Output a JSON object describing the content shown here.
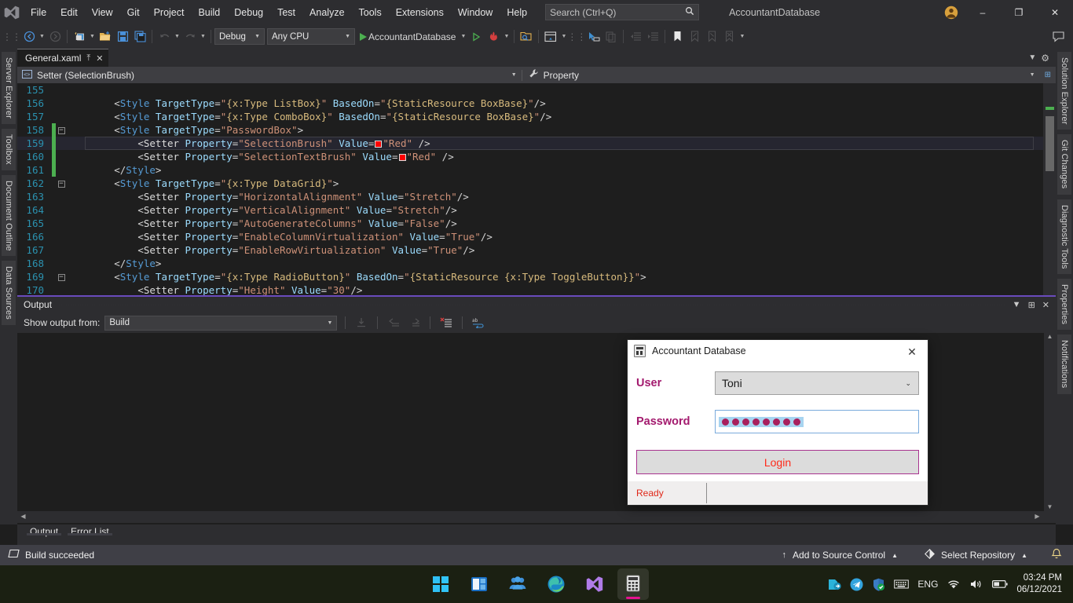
{
  "titlebar": {
    "menu": [
      "File",
      "Edit",
      "View",
      "Git",
      "Project",
      "Build",
      "Debug",
      "Test",
      "Analyze",
      "Tools",
      "Extensions",
      "Window",
      "Help"
    ],
    "search_placeholder": "Search (Ctrl+Q)",
    "search_icon": "magnifier-icon",
    "solution_title": "AccountantDatabase",
    "minimize": "–",
    "maximize": "❐",
    "close": "✕"
  },
  "toolbar": {
    "config": "Debug",
    "platform": "Any CPU",
    "start_label": "AccountantDatabase"
  },
  "dock_left": [
    "Server Explorer",
    "Toolbox",
    "Document Outline",
    "Data Sources"
  ],
  "dock_right": [
    "Solution Explorer",
    "Git Changes",
    "Diagnostic Tools",
    "Properties",
    "Notifications"
  ],
  "editor": {
    "tab_name": "General.xaml",
    "tab_pin": "⤒",
    "tab_close": "✕",
    "breadcrumb_left": "Setter (SelectionBrush)",
    "breadcrumb_right": "Property",
    "breadcrumb_left_icon": "code-tag-icon",
    "breadcrumb_right_icon": "wrench-icon",
    "lines": [
      {
        "num": "155",
        "fold": "",
        "changed": false,
        "parts": []
      },
      {
        "num": "156",
        "fold": "",
        "changed": false,
        "parts": [
          {
            "t": "        ",
            "c": "k-punct"
          },
          {
            "t": "<",
            "c": "k-punct"
          },
          {
            "t": "Style",
            "c": "k-tag"
          },
          {
            "t": " ",
            "c": "k-punct"
          },
          {
            "t": "TargetType",
            "c": "k-attr"
          },
          {
            "t": "=",
            "c": "k-punct"
          },
          {
            "t": "\"",
            "c": "k-str"
          },
          {
            "t": "{x:Type ",
            "c": "k-brace"
          },
          {
            "t": "ListBox",
            "c": "k-brace"
          },
          {
            "t": "}",
            "c": "k-brace"
          },
          {
            "t": "\"",
            "c": "k-str"
          },
          {
            "t": " ",
            "c": "k-punct"
          },
          {
            "t": "BasedOn",
            "c": "k-attr"
          },
          {
            "t": "=",
            "c": "k-punct"
          },
          {
            "t": "\"",
            "c": "k-str"
          },
          {
            "t": "{StaticResource ",
            "c": "k-brace"
          },
          {
            "t": "BoxBase",
            "c": "k-brace"
          },
          {
            "t": "}",
            "c": "k-brace"
          },
          {
            "t": "\"",
            "c": "k-str"
          },
          {
            "t": "/>",
            "c": "k-punct"
          }
        ]
      },
      {
        "num": "157",
        "fold": "",
        "changed": false,
        "parts": [
          {
            "t": "        ",
            "c": "k-punct"
          },
          {
            "t": "<",
            "c": "k-punct"
          },
          {
            "t": "Style",
            "c": "k-tag"
          },
          {
            "t": " ",
            "c": "k-punct"
          },
          {
            "t": "TargetType",
            "c": "k-attr"
          },
          {
            "t": "=",
            "c": "k-punct"
          },
          {
            "t": "\"",
            "c": "k-str"
          },
          {
            "t": "{x:Type ",
            "c": "k-brace"
          },
          {
            "t": "ComboBox",
            "c": "k-brace"
          },
          {
            "t": "}",
            "c": "k-brace"
          },
          {
            "t": "\"",
            "c": "k-str"
          },
          {
            "t": " ",
            "c": "k-punct"
          },
          {
            "t": "BasedOn",
            "c": "k-attr"
          },
          {
            "t": "=",
            "c": "k-punct"
          },
          {
            "t": "\"",
            "c": "k-str"
          },
          {
            "t": "{StaticResource ",
            "c": "k-brace"
          },
          {
            "t": "BoxBase",
            "c": "k-brace"
          },
          {
            "t": "}",
            "c": "k-brace"
          },
          {
            "t": "\"",
            "c": "k-str"
          },
          {
            "t": "/>",
            "c": "k-punct"
          }
        ]
      },
      {
        "num": "158",
        "fold": "-",
        "changed": true,
        "parts": [
          {
            "t": "        ",
            "c": "k-punct"
          },
          {
            "t": "<",
            "c": "k-punct"
          },
          {
            "t": "Style",
            "c": "k-tag"
          },
          {
            "t": " ",
            "c": "k-punct"
          },
          {
            "t": "TargetType",
            "c": "k-attr"
          },
          {
            "t": "=",
            "c": "k-punct"
          },
          {
            "t": "\"PasswordBox\"",
            "c": "k-str"
          },
          {
            "t": ">",
            "c": "k-punct"
          }
        ]
      },
      {
        "num": "159",
        "fold": "",
        "changed": true,
        "current": true,
        "parts": [
          {
            "t": "            ",
            "c": "k-punct"
          },
          {
            "t": "<",
            "c": "k-punct"
          },
          {
            "t": "Setter",
            "c": "k-white"
          },
          {
            "t": " ",
            "c": "k-punct"
          },
          {
            "t": "Property",
            "c": "k-attr"
          },
          {
            "t": "=",
            "c": "k-punct"
          },
          {
            "t": "\"SelectionBrush\"",
            "c": "k-str"
          },
          {
            "t": " ",
            "c": "k-punct"
          },
          {
            "t": "Value",
            "c": "k-attr"
          },
          {
            "t": "=",
            "c": "k-punct"
          },
          {
            "t": "@CHIP@",
            "c": "chip"
          },
          {
            "t": "\"Red\"",
            "c": "k-str"
          },
          {
            "t": " />",
            "c": "k-punct"
          }
        ]
      },
      {
        "num": "160",
        "fold": "",
        "changed": true,
        "parts": [
          {
            "t": "            ",
            "c": "k-punct"
          },
          {
            "t": "<",
            "c": "k-punct"
          },
          {
            "t": "Setter",
            "c": "k-white"
          },
          {
            "t": " ",
            "c": "k-punct"
          },
          {
            "t": "Property",
            "c": "k-attr"
          },
          {
            "t": "=",
            "c": "k-punct"
          },
          {
            "t": "\"SelectionTextBrush\"",
            "c": "k-str"
          },
          {
            "t": " ",
            "c": "k-punct"
          },
          {
            "t": "Value",
            "c": "k-attr"
          },
          {
            "t": "=",
            "c": "k-punct"
          },
          {
            "t": "@CHIP@",
            "c": "chip"
          },
          {
            "t": "\"Red\"",
            "c": "k-str"
          },
          {
            "t": " />",
            "c": "k-punct"
          }
        ]
      },
      {
        "num": "161",
        "fold": "",
        "changed": true,
        "parts": [
          {
            "t": "        ",
            "c": "k-punct"
          },
          {
            "t": "</",
            "c": "k-punct"
          },
          {
            "t": "Style",
            "c": "k-tag"
          },
          {
            "t": ">",
            "c": "k-punct"
          }
        ]
      },
      {
        "num": "162",
        "fold": "-",
        "changed": false,
        "parts": [
          {
            "t": "        ",
            "c": "k-punct"
          },
          {
            "t": "<",
            "c": "k-punct"
          },
          {
            "t": "Style",
            "c": "k-tag"
          },
          {
            "t": " ",
            "c": "k-punct"
          },
          {
            "t": "TargetType",
            "c": "k-attr"
          },
          {
            "t": "=",
            "c": "k-punct"
          },
          {
            "t": "\"",
            "c": "k-str"
          },
          {
            "t": "{x:Type ",
            "c": "k-brace"
          },
          {
            "t": "DataGrid",
            "c": "k-brace"
          },
          {
            "t": "}",
            "c": "k-brace"
          },
          {
            "t": "\"",
            "c": "k-str"
          },
          {
            "t": ">",
            "c": "k-punct"
          }
        ]
      },
      {
        "num": "163",
        "fold": "",
        "changed": false,
        "parts": [
          {
            "t": "            ",
            "c": "k-punct"
          },
          {
            "t": "<",
            "c": "k-punct"
          },
          {
            "t": "Setter",
            "c": "k-white"
          },
          {
            "t": " ",
            "c": "k-punct"
          },
          {
            "t": "Property",
            "c": "k-attr"
          },
          {
            "t": "=",
            "c": "k-punct"
          },
          {
            "t": "\"HorizontalAlignment\"",
            "c": "k-str"
          },
          {
            "t": " ",
            "c": "k-punct"
          },
          {
            "t": "Value",
            "c": "k-attr"
          },
          {
            "t": "=",
            "c": "k-punct"
          },
          {
            "t": "\"Stretch\"",
            "c": "k-str"
          },
          {
            "t": "/>",
            "c": "k-punct"
          }
        ]
      },
      {
        "num": "164",
        "fold": "",
        "changed": false,
        "parts": [
          {
            "t": "            ",
            "c": "k-punct"
          },
          {
            "t": "<",
            "c": "k-punct"
          },
          {
            "t": "Setter",
            "c": "k-white"
          },
          {
            "t": " ",
            "c": "k-punct"
          },
          {
            "t": "Property",
            "c": "k-attr"
          },
          {
            "t": "=",
            "c": "k-punct"
          },
          {
            "t": "\"VerticalAlignment\"",
            "c": "k-str"
          },
          {
            "t": " ",
            "c": "k-punct"
          },
          {
            "t": "Value",
            "c": "k-attr"
          },
          {
            "t": "=",
            "c": "k-punct"
          },
          {
            "t": "\"Stretch\"",
            "c": "k-str"
          },
          {
            "t": "/>",
            "c": "k-punct"
          }
        ]
      },
      {
        "num": "165",
        "fold": "",
        "changed": false,
        "parts": [
          {
            "t": "            ",
            "c": "k-punct"
          },
          {
            "t": "<",
            "c": "k-punct"
          },
          {
            "t": "Setter",
            "c": "k-white"
          },
          {
            "t": " ",
            "c": "k-punct"
          },
          {
            "t": "Property",
            "c": "k-attr"
          },
          {
            "t": "=",
            "c": "k-punct"
          },
          {
            "t": "\"AutoGenerateColumns\"",
            "c": "k-str"
          },
          {
            "t": " ",
            "c": "k-punct"
          },
          {
            "t": "Value",
            "c": "k-attr"
          },
          {
            "t": "=",
            "c": "k-punct"
          },
          {
            "t": "\"False\"",
            "c": "k-str"
          },
          {
            "t": "/>",
            "c": "k-punct"
          }
        ]
      },
      {
        "num": "166",
        "fold": "",
        "changed": false,
        "parts": [
          {
            "t": "            ",
            "c": "k-punct"
          },
          {
            "t": "<",
            "c": "k-punct"
          },
          {
            "t": "Setter",
            "c": "k-white"
          },
          {
            "t": " ",
            "c": "k-punct"
          },
          {
            "t": "Property",
            "c": "k-attr"
          },
          {
            "t": "=",
            "c": "k-punct"
          },
          {
            "t": "\"EnableColumnVirtualization\"",
            "c": "k-str"
          },
          {
            "t": " ",
            "c": "k-punct"
          },
          {
            "t": "Value",
            "c": "k-attr"
          },
          {
            "t": "=",
            "c": "k-punct"
          },
          {
            "t": "\"True\"",
            "c": "k-str"
          },
          {
            "t": "/>",
            "c": "k-punct"
          }
        ]
      },
      {
        "num": "167",
        "fold": "",
        "changed": false,
        "parts": [
          {
            "t": "            ",
            "c": "k-punct"
          },
          {
            "t": "<",
            "c": "k-punct"
          },
          {
            "t": "Setter",
            "c": "k-white"
          },
          {
            "t": " ",
            "c": "k-punct"
          },
          {
            "t": "Property",
            "c": "k-attr"
          },
          {
            "t": "=",
            "c": "k-punct"
          },
          {
            "t": "\"EnableRowVirtualization\"",
            "c": "k-str"
          },
          {
            "t": " ",
            "c": "k-punct"
          },
          {
            "t": "Value",
            "c": "k-attr"
          },
          {
            "t": "=",
            "c": "k-punct"
          },
          {
            "t": "\"True\"",
            "c": "k-str"
          },
          {
            "t": "/>",
            "c": "k-punct"
          }
        ]
      },
      {
        "num": "168",
        "fold": "",
        "changed": false,
        "parts": [
          {
            "t": "        ",
            "c": "k-punct"
          },
          {
            "t": "</",
            "c": "k-punct"
          },
          {
            "t": "Style",
            "c": "k-tag"
          },
          {
            "t": ">",
            "c": "k-punct"
          }
        ]
      },
      {
        "num": "169",
        "fold": "-",
        "changed": false,
        "parts": [
          {
            "t": "        ",
            "c": "k-punct"
          },
          {
            "t": "<",
            "c": "k-punct"
          },
          {
            "t": "Style",
            "c": "k-tag"
          },
          {
            "t": " ",
            "c": "k-punct"
          },
          {
            "t": "TargetType",
            "c": "k-attr"
          },
          {
            "t": "=",
            "c": "k-punct"
          },
          {
            "t": "\"",
            "c": "k-str"
          },
          {
            "t": "{x:Type ",
            "c": "k-brace"
          },
          {
            "t": "RadioButton",
            "c": "k-brace"
          },
          {
            "t": "}",
            "c": "k-brace"
          },
          {
            "t": "\"",
            "c": "k-str"
          },
          {
            "t": " ",
            "c": "k-punct"
          },
          {
            "t": "BasedOn",
            "c": "k-attr"
          },
          {
            "t": "=",
            "c": "k-punct"
          },
          {
            "t": "\"",
            "c": "k-str"
          },
          {
            "t": "{StaticResource ",
            "c": "k-brace"
          },
          {
            "t": "{x:Type ",
            "c": "k-brace"
          },
          {
            "t": "ToggleButton",
            "c": "k-brace"
          },
          {
            "t": "}}",
            "c": "k-brace"
          },
          {
            "t": "\"",
            "c": "k-str"
          },
          {
            "t": ">",
            "c": "k-punct"
          }
        ]
      },
      {
        "num": "170",
        "fold": "",
        "changed": false,
        "parts": [
          {
            "t": "            ",
            "c": "k-punct"
          },
          {
            "t": "<",
            "c": "k-punct"
          },
          {
            "t": "Setter",
            "c": "k-white"
          },
          {
            "t": " ",
            "c": "k-punct"
          },
          {
            "t": "Property",
            "c": "k-attr"
          },
          {
            "t": "=",
            "c": "k-punct"
          },
          {
            "t": "\"Height\"",
            "c": "k-str"
          },
          {
            "t": " ",
            "c": "k-punct"
          },
          {
            "t": "Value",
            "c": "k-attr"
          },
          {
            "t": "=",
            "c": "k-punct"
          },
          {
            "t": "\"30\"",
            "c": "k-str"
          },
          {
            "t": "/>",
            "c": "k-punct"
          }
        ]
      }
    ]
  },
  "output": {
    "title": "Output",
    "show_output_from_label": "Show output from:",
    "source": "Build",
    "body_text": ""
  },
  "bottom_tabs": [
    "Output",
    "Error List"
  ],
  "statusbar": {
    "build_message": "Build succeeded",
    "build_icon": "build-status-icon",
    "add_source_control": "Add to Source Control",
    "add_source_control_icon": "up-arrow-icon",
    "select_repository": "Select Repository",
    "select_repository_icon": "git-repo-icon",
    "notification_icon": "bell-icon"
  },
  "dialog": {
    "title": "Accountant Database",
    "title_icon": "calculator-icon",
    "close": "✕",
    "user_label": "User",
    "user_value": "Toni",
    "password_label": "Password",
    "password_dots": 8,
    "login_button": "Login",
    "status_text": "Ready",
    "accent_color": "#a8338f",
    "label_color": "#a31a6e",
    "login_text_color": "#ff2a1a",
    "status_color": "#e02718"
  },
  "taskbar": {
    "apps": [
      "start-icon",
      "widgets-icon",
      "teams-icon",
      "edge-icon",
      "visual-studio-icon",
      "calculator-icon"
    ],
    "tray": [
      "sync-icon",
      "telegram-icon",
      "defender-icon",
      "keyboard-icon"
    ],
    "language": "ENG",
    "network_icon": "wifi-icon",
    "volume_icon": "speaker-icon",
    "battery_icon": "battery-icon",
    "time": "03:24 PM",
    "date": "06/12/2021"
  }
}
